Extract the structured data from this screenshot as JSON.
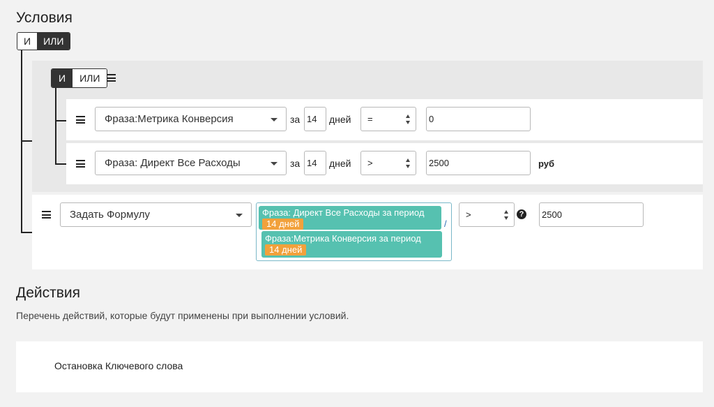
{
  "conditions": {
    "title": "Условия",
    "root_toggle": {
      "and": "И",
      "or": "ИЛИ",
      "active": "or"
    },
    "group": {
      "toggle": {
        "and": "И",
        "or": "ИЛИ",
        "active": "and"
      },
      "rows": [
        {
          "metric": "Фраза:Метрика Конверсия",
          "for_label": "за",
          "days": "14",
          "days_label": "дней",
          "operator": "=",
          "value": "0",
          "unit": ""
        },
        {
          "metric": "Фраза: Директ Все Расходы",
          "for_label": "за",
          "days": "14",
          "days_label": "дней",
          "operator": ">",
          "value": "2500",
          "unit": "руб"
        }
      ]
    },
    "formula_row": {
      "type": "Задать Формулу",
      "numerator": {
        "text": "Фраза: Директ Все Расходы за период",
        "badge": "14 дней"
      },
      "divider": "/",
      "denominator": {
        "text": "Фраза:Метрика Конверсия за период",
        "badge": "14 дней"
      },
      "operator": ">",
      "help_icon": "question-circle-icon",
      "value": "2500"
    }
  },
  "actions": {
    "title": "Действия",
    "description": "Перечень действий, которые будут применены при выполнении условий.",
    "items": [
      "Остановка Ключевого слова"
    ]
  },
  "colors": {
    "chip": "#56c1b0",
    "badge": "#f2a13b",
    "dark": "#333333"
  }
}
